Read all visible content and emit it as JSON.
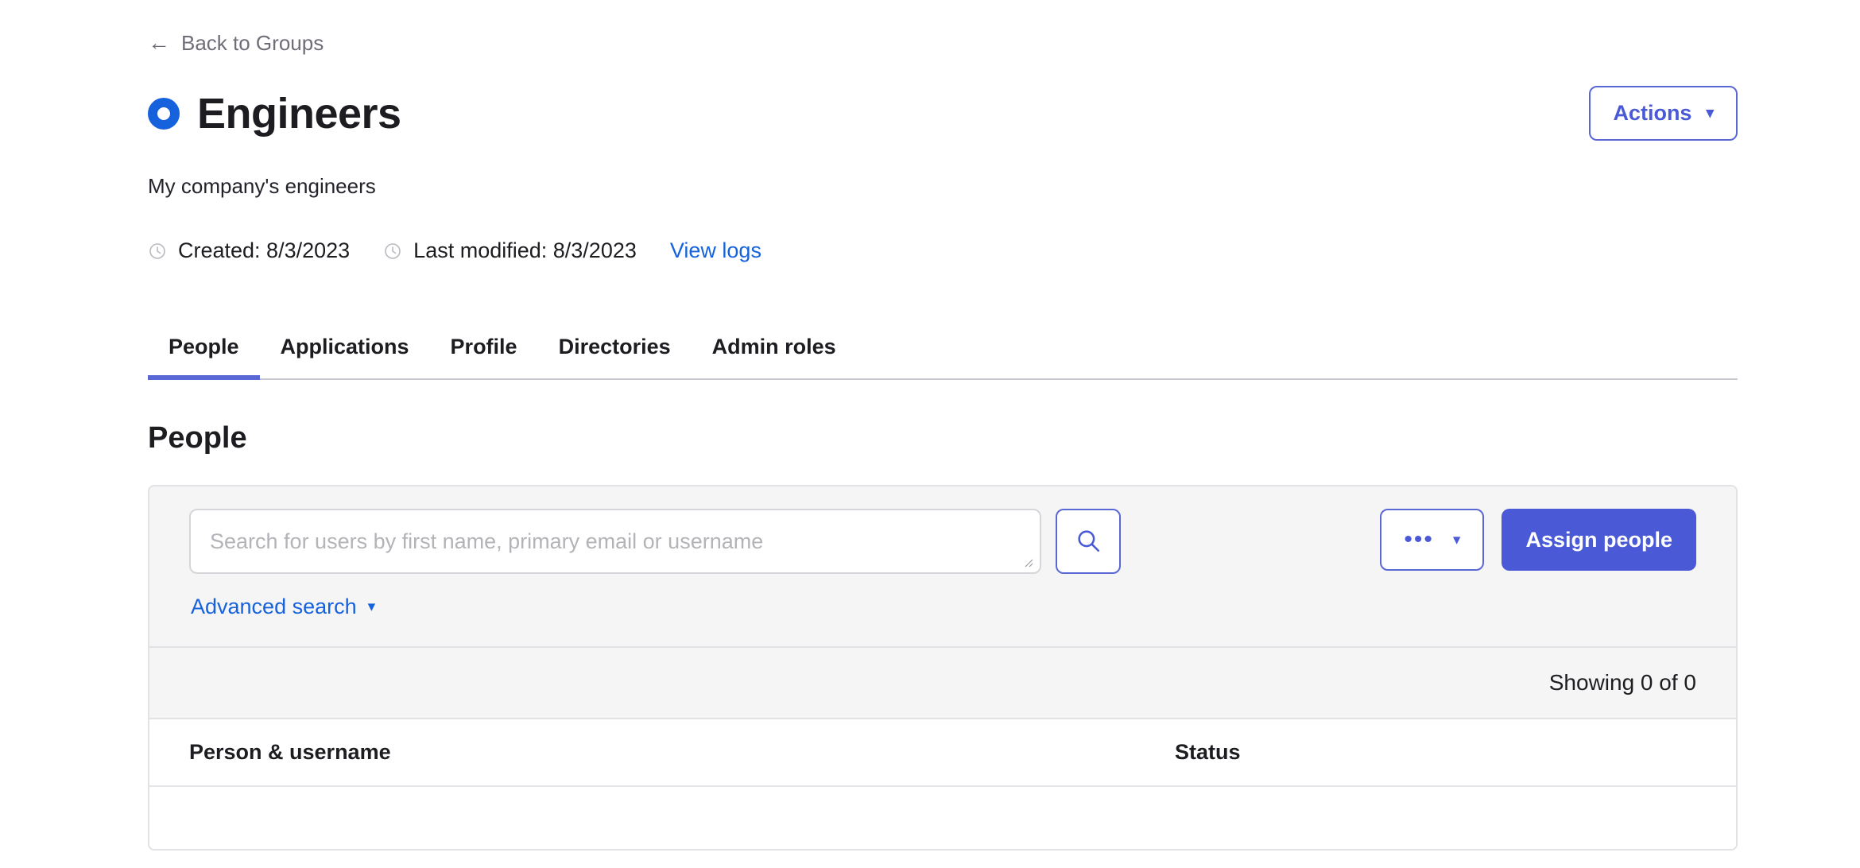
{
  "back": {
    "label": "Back to Groups",
    "icon": "arrow-left-icon"
  },
  "header": {
    "title": "Engineers",
    "icon": "group-ring-icon",
    "actions_button": {
      "label": "Actions",
      "caret": "▾"
    }
  },
  "description": "My company's engineers",
  "meta": {
    "created_label": "Created: 8/3/2023",
    "modified_label": "Last modified: 8/3/2023",
    "view_logs_label": "View logs",
    "clock_icon": "clock-icon"
  },
  "tabs": [
    {
      "label": "People",
      "active": true
    },
    {
      "label": "Applications",
      "active": false
    },
    {
      "label": "Profile",
      "active": false
    },
    {
      "label": "Directories",
      "active": false
    },
    {
      "label": "Admin roles",
      "active": false
    }
  ],
  "section": {
    "heading": "People"
  },
  "toolbar": {
    "search": {
      "placeholder": "Search for users by first name, primary email or username",
      "value": "",
      "button_icon": "search-icon"
    },
    "advanced_search": {
      "label": "Advanced search",
      "caret": "▾"
    },
    "more_menu": {
      "dots": "•••",
      "caret": "▾"
    },
    "assign_button": {
      "label": "Assign people"
    }
  },
  "table": {
    "count_text": "Showing 0 of 0",
    "columns": [
      {
        "label": "Person & username"
      },
      {
        "label": "Status"
      }
    ],
    "rows": []
  },
  "colors": {
    "brand_blue": "#4a5ad6",
    "link_blue": "#1662dd",
    "ring_blue": "#1662dd",
    "text_dark": "#1d1d21",
    "muted_gray": "#6e6e78",
    "panel_gray": "#f5f5f6",
    "border_gray": "#e2e2e6"
  }
}
